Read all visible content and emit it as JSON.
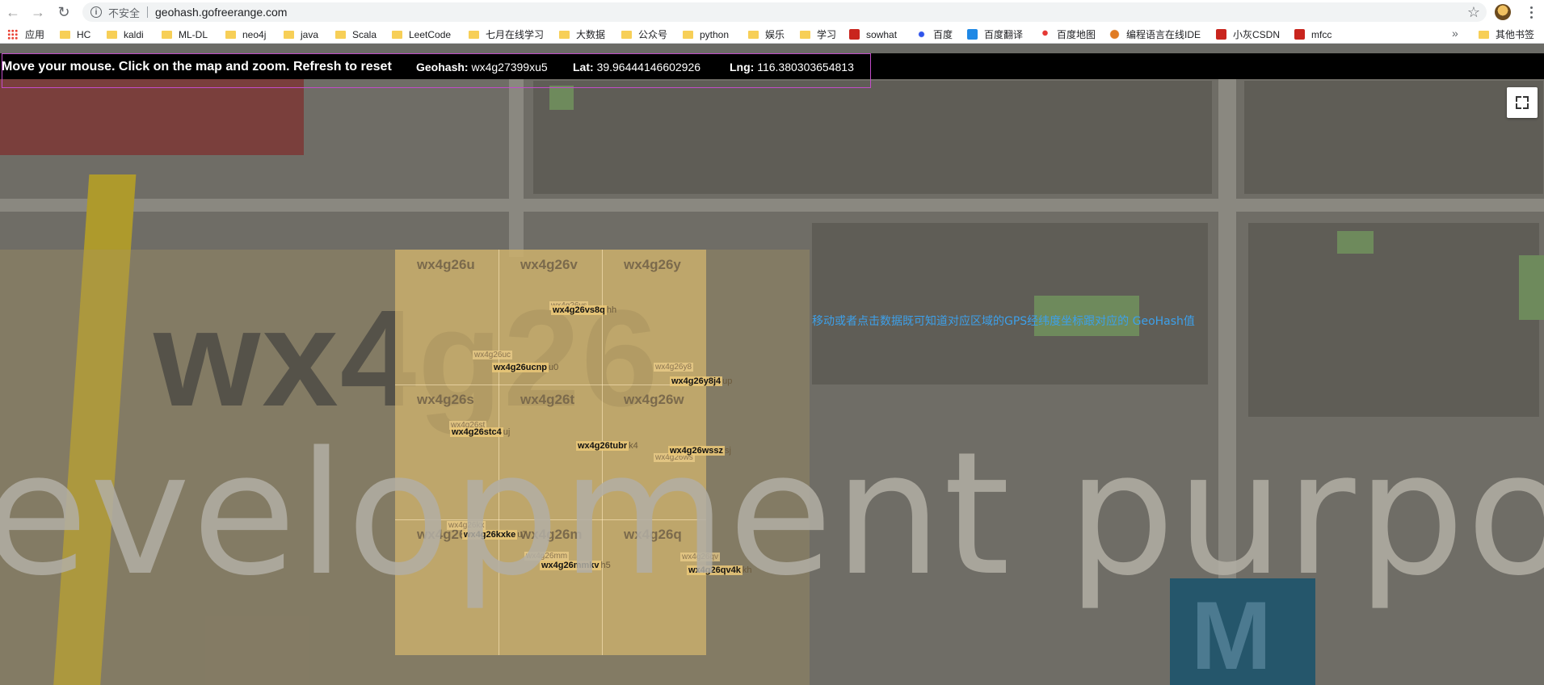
{
  "browser": {
    "security_label": "不安全",
    "url": "geohash.gofreerange.com",
    "icons": [
      "back-icon",
      "forward-icon",
      "reload-icon",
      "info-icon",
      "star-icon",
      "profile-icon",
      "menu-icon"
    ]
  },
  "bookmarks": {
    "items": [
      {
        "label": "应用",
        "icon": "apps-icon"
      },
      {
        "label": "HC",
        "icon": "folder-icon"
      },
      {
        "label": "kaldi",
        "icon": "folder-icon"
      },
      {
        "label": "ML-DL",
        "icon": "folder-icon"
      },
      {
        "label": "neo4j",
        "icon": "folder-icon"
      },
      {
        "label": "java",
        "icon": "folder-icon"
      },
      {
        "label": "Scala",
        "icon": "folder-icon"
      },
      {
        "label": "LeetCode",
        "icon": "folder-icon"
      },
      {
        "label": "七月在线学习",
        "icon": "folder-icon"
      },
      {
        "label": "大数据",
        "icon": "folder-icon"
      },
      {
        "label": "公众号",
        "icon": "folder-icon"
      },
      {
        "label": "python",
        "icon": "folder-icon"
      },
      {
        "label": "娱乐",
        "icon": "folder-icon"
      },
      {
        "label": "学习",
        "icon": "folder-icon"
      },
      {
        "label": "sowhat",
        "icon": "csdn-icon"
      },
      {
        "label": "百度",
        "icon": "baidu-icon"
      },
      {
        "label": "百度翻译",
        "icon": "fanyi-icon"
      },
      {
        "label": "百度地图",
        "icon": "map-pin-icon"
      },
      {
        "label": "编程语言在线IDE",
        "icon": "ide-icon"
      },
      {
        "label": "小灰CSDN",
        "icon": "csdn-icon"
      },
      {
        "label": "mfcc",
        "icon": "csdn-icon"
      }
    ],
    "more_label": "»",
    "other_label": "其他书签"
  },
  "header": {
    "instructions": "Move your mouse. Click on the map and zoom. Refresh to reset",
    "geohash_label": "Geohash:",
    "geohash_value": "wx4g27399xu5",
    "lat_label": "Lat:",
    "lat_value": "39.96444146602926",
    "lng_label": "Lng:",
    "lng_value": "116.380303654813"
  },
  "map": {
    "watermark_big": "wx4g26",
    "watermark_dev": "evelopment purpos",
    "metro_letter": "M",
    "cells": [
      "wx4g26u",
      "wx4g26v",
      "wx4g26y",
      "wx4g26s",
      "wx4g26t",
      "wx4g26w",
      "wx4g26k",
      "wx4g26m",
      "wx4g26q"
    ],
    "ghost_tags": [
      "wx4g26vs",
      "wx4g26uc",
      "wx4g26y8",
      "wx4g26st",
      "wx4g26ws",
      "wx4g26kx",
      "wx4g26mm",
      "wx4g26qv"
    ],
    "tags": [
      {
        "pre": "wx4g26vs8q",
        "suf": "hh"
      },
      {
        "pre": "wx4g26ucnp",
        "suf": "u0"
      },
      {
        "pre": "wx4g26y8j4",
        "suf": "up"
      },
      {
        "pre": "wx4g26stc4",
        "suf": "uj"
      },
      {
        "pre": "wx4g26tubr",
        "suf": "k4"
      },
      {
        "pre": "wx4g26wssz",
        "suf": "sj"
      },
      {
        "pre": "wx4g26kxke",
        "suf": "u7"
      },
      {
        "pre": "wx4g26mmkv",
        "suf": "h5"
      },
      {
        "pre": "wx4g26qv4k",
        "suf": "kh"
      }
    ],
    "info_text": "移动或者点击数据既可知道对应区域的GPS经纬度坐标跟对应的 GeoHash值"
  },
  "colors": {
    "header_bg": "#000000",
    "grid_fill": "#d2b46e",
    "info_text": "#3da0ea",
    "outline": "#c24cc9"
  }
}
